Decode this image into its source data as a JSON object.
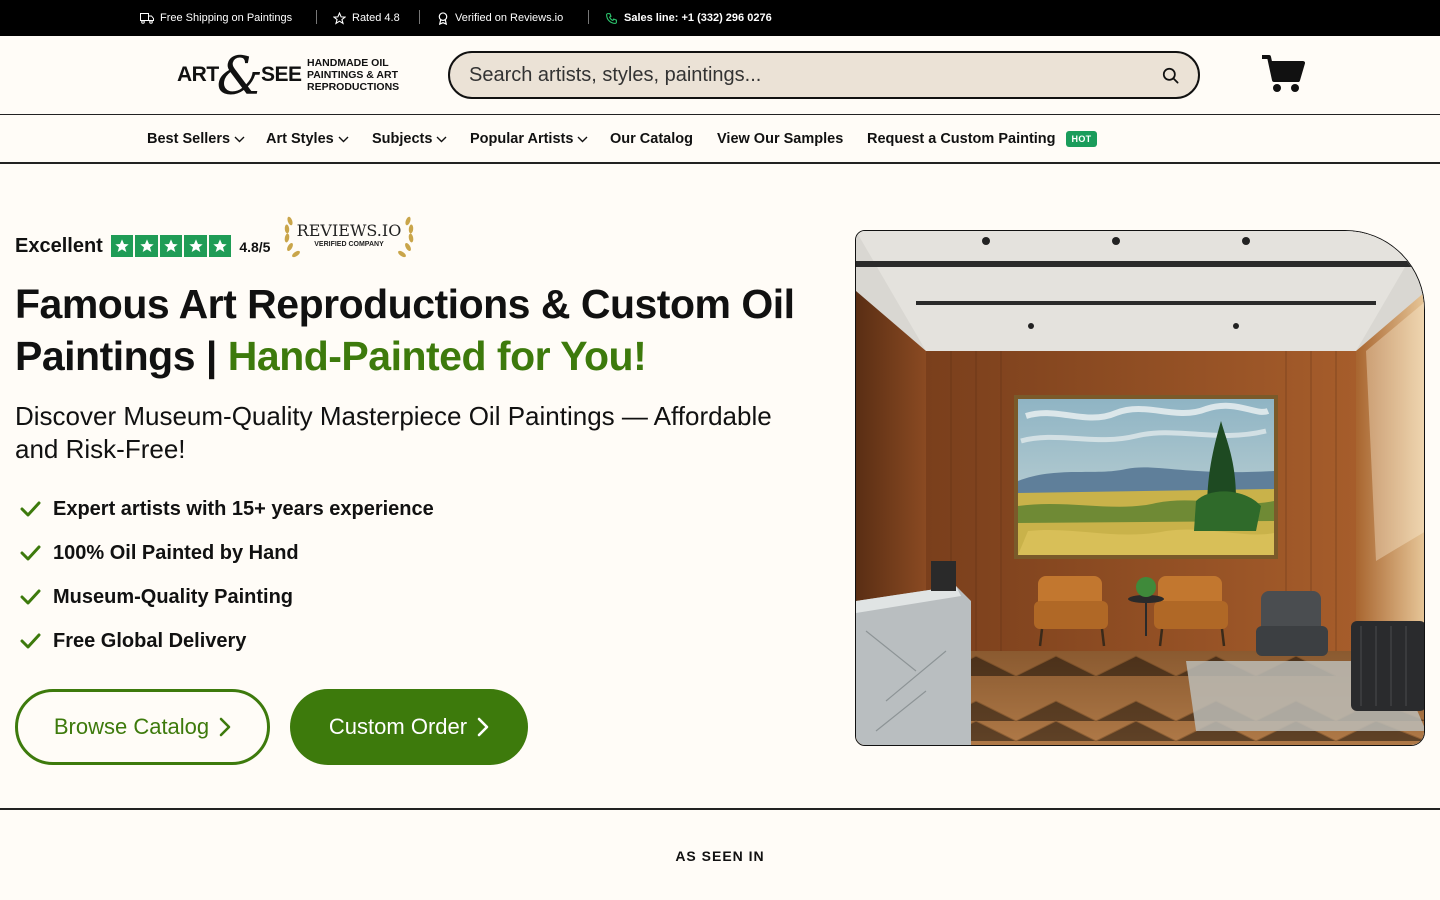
{
  "topbar": {
    "shipping": "Free Shipping on Paintings",
    "rated": "Rated 4.8",
    "verified": "Verified on Reviews.io",
    "sales": "Sales line: +1 (332) 296 0276"
  },
  "header": {
    "logo_left": "ART",
    "logo_amp": "&",
    "logo_right": "SEE",
    "tagline": [
      "HANDMADE OIL",
      "PAINTINGS & ART",
      "REPRODUCTIONS"
    ],
    "search_placeholder": "Search artists, styles, paintings..."
  },
  "nav": {
    "items": [
      {
        "label": "Best Sellers",
        "dropdown": true
      },
      {
        "label": "Art Styles",
        "dropdown": true
      },
      {
        "label": "Subjects",
        "dropdown": true
      },
      {
        "label": "Popular Artists",
        "dropdown": true
      },
      {
        "label": "Our Catalog",
        "dropdown": false
      },
      {
        "label": "View Our Samples",
        "dropdown": false
      },
      {
        "label": "Request a Custom Painting",
        "dropdown": false,
        "badge": "HOT"
      }
    ]
  },
  "hero": {
    "rating_label": "Excellent",
    "rating_score": "4.8/5",
    "rating_stars": 5,
    "badge_title": "REVIEWS.IO",
    "badge_sub": "VERIFIED COMPANY",
    "title_main": "Famous Art Reproductions & Custom Oil Paintings | ",
    "title_accent": "Hand-Painted for You!",
    "subtitle": "Discover Museum-Quality Masterpiece Oil Paintings — Affordable and Risk-Free!",
    "features": [
      "Expert artists with 15+ years experience",
      "100% Oil Painted by Hand",
      "Museum-Quality Painting",
      "Free Global Delivery"
    ],
    "btn_browse": "Browse Catalog",
    "btn_custom": "Custom Order"
  },
  "seen_in": "AS SEEN IN",
  "colors": {
    "accent_green": "#3d7a0c",
    "star_green": "#1f9c56",
    "hot_badge": "#1a9c5b",
    "search_bg": "#ebe2d6",
    "page_bg": "#fffcf7"
  }
}
